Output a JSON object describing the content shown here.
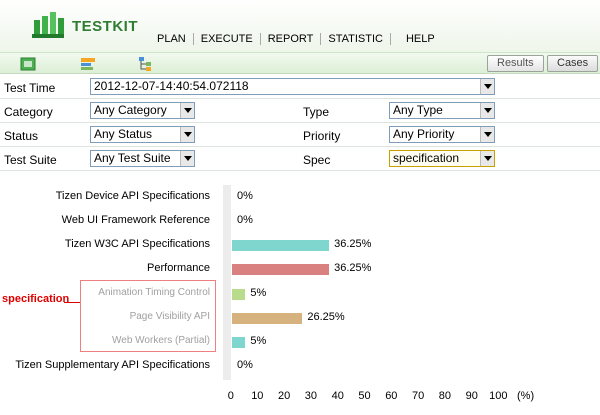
{
  "app": {
    "logo_text": "TESTKIT",
    "nav": [
      "PLAN",
      "EXECUTE",
      "REPORT",
      "STATISTIC",
      "HELP"
    ]
  },
  "toolbar": {
    "icons": [
      "green-cube-icon",
      "bars-icon",
      "tree-icon"
    ],
    "results_label": "Results",
    "cases_label": "Cases"
  },
  "form": {
    "test_time": {
      "label": "Test Time",
      "value": "2012-12-07-14:40:54.072118"
    },
    "category": {
      "label": "Category",
      "value": "Any Category"
    },
    "type": {
      "label": "Type",
      "value": "Any Type"
    },
    "status": {
      "label": "Status",
      "value": "Any Status"
    },
    "priority": {
      "label": "Priority",
      "value": "Any Priority"
    },
    "test_suite": {
      "label": "Test Suite",
      "value": "Any Test Suite"
    },
    "spec": {
      "label": "Spec",
      "value": "specification"
    }
  },
  "annotation": {
    "text": "specification",
    "color": "#e00000"
  },
  "chart_data": {
    "type": "bar",
    "orientation": "horizontal",
    "categories": [
      "Tizen Device API Specifications",
      "Web UI Framework Reference",
      "Tizen W3C API Specifications",
      "Performance",
      "Animation Timing Control",
      "Page Visibility API",
      "Web Workers (Partial)",
      "Tizen Supplementary API Specifications"
    ],
    "values": [
      0,
      0,
      36.25,
      36.25,
      5,
      26.25,
      5,
      0
    ],
    "value_labels": [
      "0%",
      "0%",
      "36.25%",
      "36.25%",
      "5%",
      "26.25%",
      "5%",
      "0%"
    ],
    "colors": [
      "#7ed6cf",
      "#7ed6cf",
      "#7ed6cf",
      "#d98080",
      "#b8dc8c",
      "#d6b27e",
      "#7ed6cf",
      "#7ed6cf"
    ],
    "dimmed": [
      false,
      false,
      false,
      false,
      true,
      true,
      true,
      false
    ],
    "xticks": [
      "0",
      "10",
      "20",
      "30",
      "40",
      "50",
      "60",
      "70",
      "80",
      "90",
      "100"
    ],
    "xunit": "(%)",
    "xlim": [
      0,
      100
    ]
  }
}
